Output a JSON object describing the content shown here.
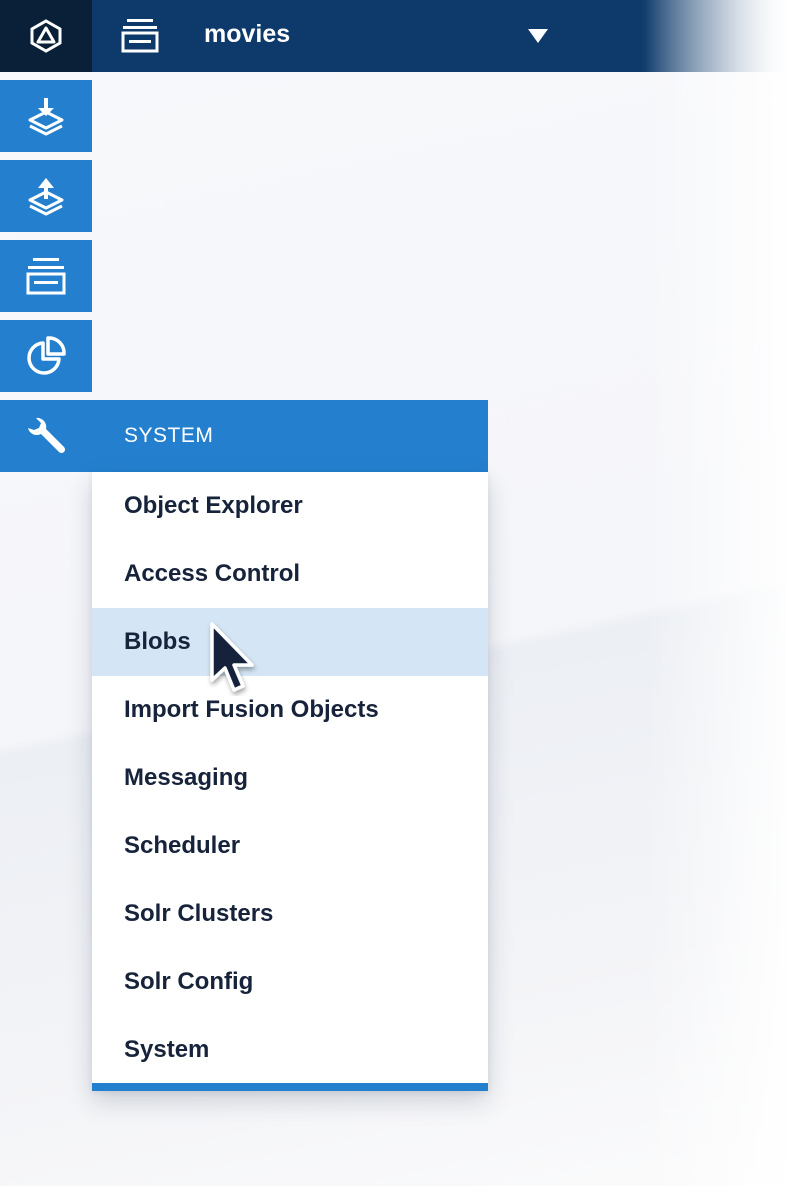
{
  "header": {
    "logo_icon": "fusion-logo-icon",
    "app_icon": "app-stack-icon",
    "app_name": "movies",
    "caret_icon": "triangle-down-icon"
  },
  "sidebar": {
    "items": [
      {
        "icon": "index-workbench-icon",
        "label": ""
      },
      {
        "icon": "query-workbench-icon",
        "label": ""
      },
      {
        "icon": "collections-icon",
        "label": ""
      },
      {
        "icon": "analytics-pie-icon",
        "label": ""
      },
      {
        "icon": "wrench-icon",
        "label": "SYSTEM"
      }
    ]
  },
  "menu": {
    "items": [
      "Object Explorer",
      "Access Control",
      "Blobs",
      "Import Fusion Objects",
      "Messaging",
      "Scheduler",
      "Solr Clusters",
      "Solr Config",
      "System"
    ],
    "hovered": "Blobs"
  },
  "colors": {
    "topbar": "#0d3a6b",
    "logo_bg": "#0a1f38",
    "accent": "#2480cf",
    "hover": "#d4e5f5",
    "menu_text": "#16233b"
  }
}
